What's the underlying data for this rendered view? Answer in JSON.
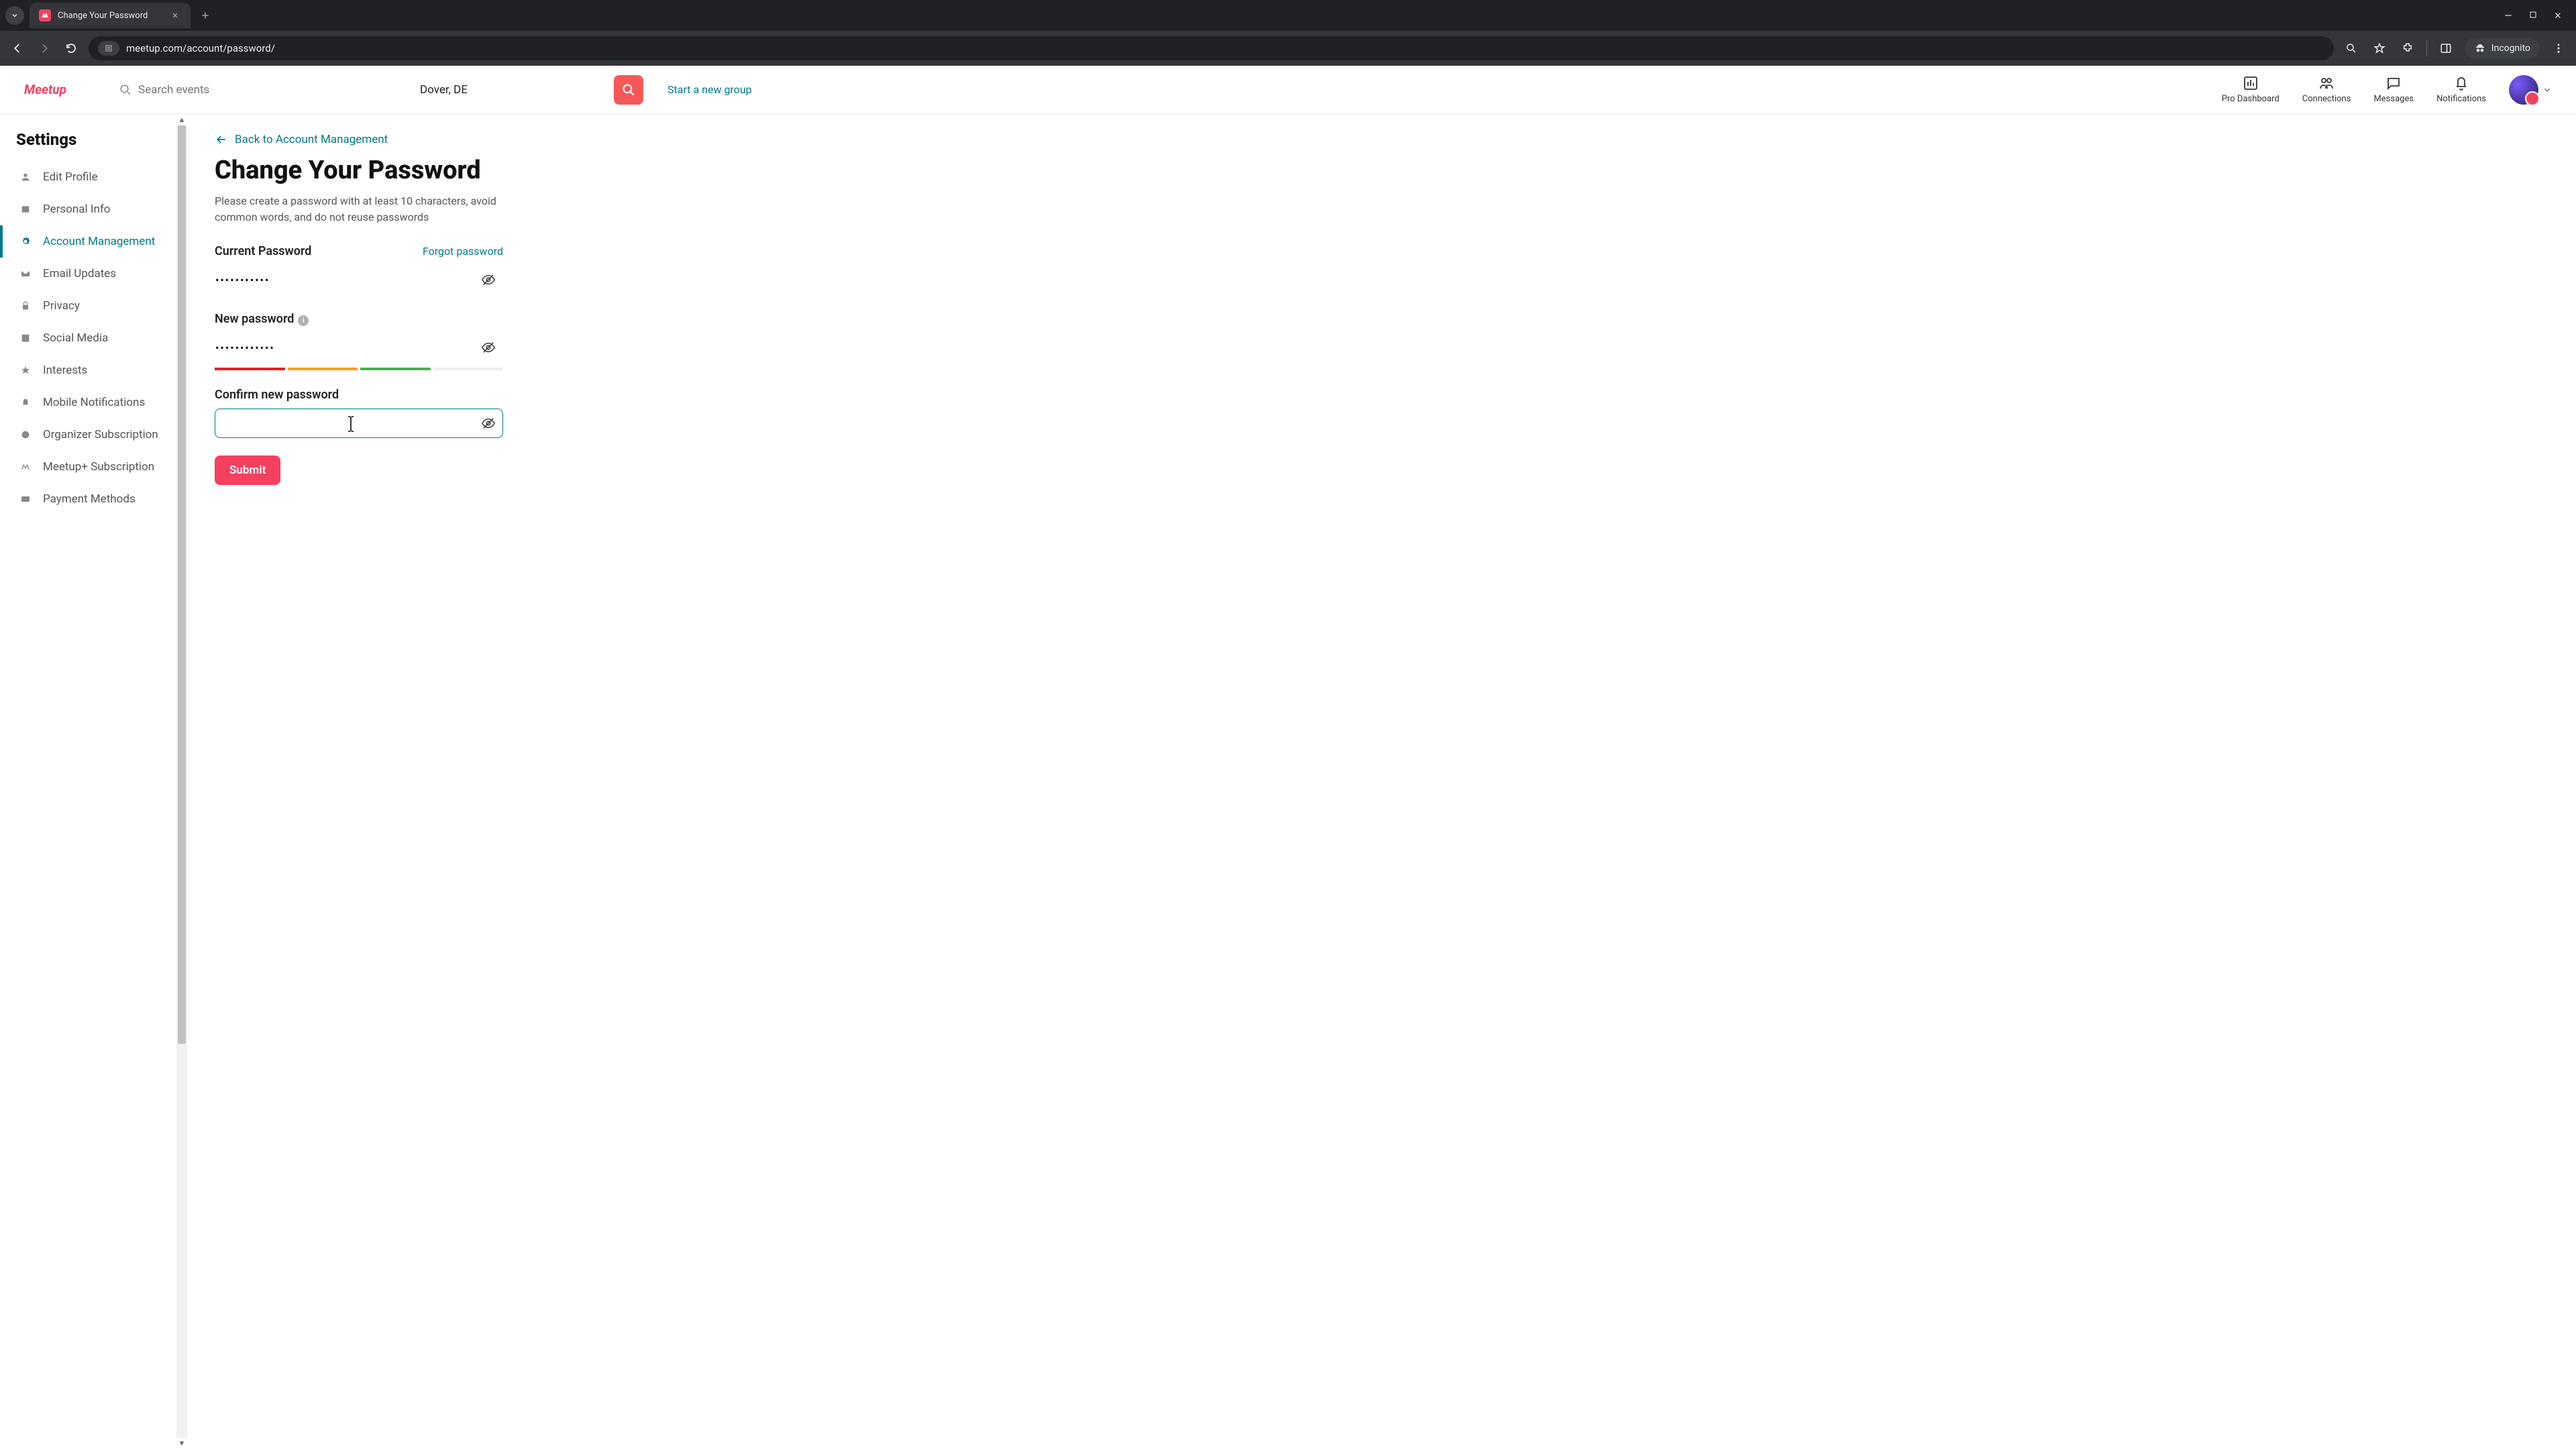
{
  "browser": {
    "tab_title": "Change Your Password",
    "url": "meetup.com/account/password/",
    "incognito_label": "Incognito"
  },
  "header": {
    "search_placeholder": "Search events",
    "location": "Dover, DE",
    "start_group": "Start a new group",
    "nav": {
      "pro_dashboard": "Pro Dashboard",
      "connections": "Connections",
      "messages": "Messages",
      "notifications": "Notifications"
    }
  },
  "sidebar": {
    "title": "Settings",
    "items": [
      {
        "label": "Edit Profile"
      },
      {
        "label": "Personal Info"
      },
      {
        "label": "Account Management"
      },
      {
        "label": "Email Updates"
      },
      {
        "label": "Privacy"
      },
      {
        "label": "Social Media"
      },
      {
        "label": "Interests"
      },
      {
        "label": "Mobile Notifications"
      },
      {
        "label": "Organizer Subscription"
      },
      {
        "label": "Meetup+ Subscription"
      },
      {
        "label": "Payment Methods"
      }
    ]
  },
  "main": {
    "back_link": "Back to Account Management",
    "title": "Change Your Password",
    "subtitle": "Please create a password with at least 10 characters, avoid common words, and do not reuse passwords",
    "current_label": "Current Password",
    "forgot": "Forgot password",
    "current_value": "•••••••••••",
    "new_label": "New password",
    "new_value": "••••••••••••",
    "confirm_label": "Confirm new password",
    "confirm_value": "",
    "submit": "Submit"
  }
}
